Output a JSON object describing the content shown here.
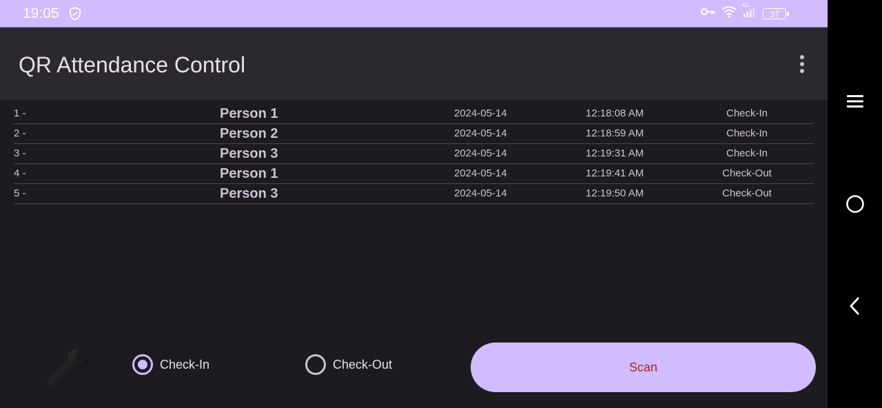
{
  "status_bar": {
    "time": "19:05",
    "battery": "37",
    "network": "4G",
    "icons": [
      "shield-icon",
      "key-icon",
      "wifi-icon",
      "signal-icon",
      "battery-icon"
    ]
  },
  "app_bar": {
    "title": "QR Attendance Control",
    "menu_icon": "more-vert-icon"
  },
  "records": [
    {
      "index": "1 -",
      "name": "Person 1",
      "date": "2024-05-14",
      "time": "12:18:08 AM",
      "type": "Check-In"
    },
    {
      "index": "2 -",
      "name": "Person 2",
      "date": "2024-05-14",
      "time": "12:18:59 AM",
      "type": "Check-In"
    },
    {
      "index": "3 -",
      "name": "Person 3",
      "date": "2024-05-14",
      "time": "12:19:31 AM",
      "type": "Check-In"
    },
    {
      "index": "4 -",
      "name": "Person 1",
      "date": "2024-05-14",
      "time": "12:19:41 AM",
      "type": "Check-Out"
    },
    {
      "index": "5 -",
      "name": "Person 3",
      "date": "2024-05-14",
      "time": "12:19:50 AM",
      "type": "Check-Out"
    }
  ],
  "controls": {
    "settings_icon": "wrench-icon",
    "check_in_label": "Check-In",
    "check_out_label": "Check-Out",
    "selected": "Check-In",
    "scan_label": "Scan"
  },
  "navigation_bar": {
    "icons": [
      "menu-icon",
      "home-icon",
      "back-icon"
    ]
  },
  "colors": {
    "accent": "#d0bcfe",
    "background": "#1d1b20",
    "app_bar": "#2b2930",
    "scan_text": "#b3261e"
  }
}
